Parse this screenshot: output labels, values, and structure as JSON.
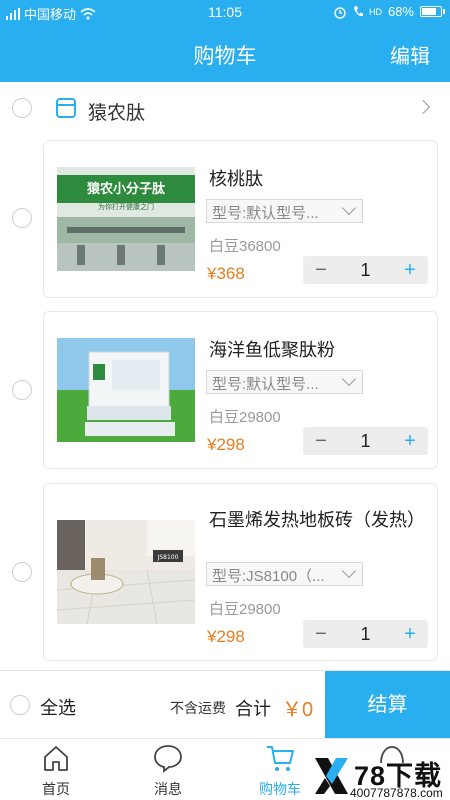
{
  "status_bar": {
    "carrier": "中国移动",
    "time": "11:05",
    "battery": "68%",
    "battery_level": 0.68,
    "volte_label": "HD"
  },
  "header": {
    "title": "购物车",
    "edit_label": "编辑"
  },
  "store": {
    "name": "猿农肽"
  },
  "items": [
    {
      "name": "核桃肽",
      "model": "型号:默认型号...",
      "beans": "白豆36800",
      "price": "¥368",
      "quantity": "1",
      "image_text": "猿农小分子肽",
      "image_subtext": "为你打开健康之门"
    },
    {
      "name": "海洋鱼低聚肽粉",
      "model": "型号:默认型号...",
      "beans": "白豆29800",
      "price": "¥298",
      "quantity": "1"
    },
    {
      "name": "石墨烯发热地板砖（发热）",
      "model": "型号:JS8100（...",
      "beans": "白豆29800",
      "price": "¥298",
      "quantity": "1",
      "image_text": "JS8100"
    }
  ],
  "stepper": {
    "minus": "−",
    "plus": "+"
  },
  "checkout": {
    "select_all": "全选",
    "no_shipping": "不含运费",
    "total_label": "合计",
    "total_value": "￥0",
    "button_label": "结算"
  },
  "tabs": [
    {
      "label": "首页"
    },
    {
      "label": "消息"
    },
    {
      "label": "购物车"
    },
    {
      "label": ""
    }
  ],
  "watermark": {
    "brand": "78下载",
    "url": "4007787878.com"
  },
  "colors": {
    "accent": "#29aef0",
    "price": "#e67e22"
  }
}
